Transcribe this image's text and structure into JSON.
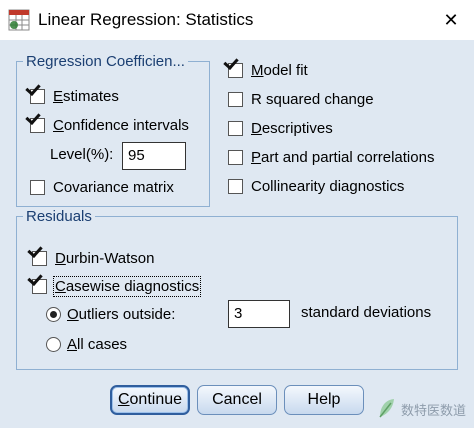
{
  "window": {
    "title": "Linear Regression: Statistics",
    "close_label": "✕"
  },
  "regression_coefficients": {
    "legend": "Regression Coefficien...",
    "estimates": {
      "label": "Estimates",
      "checked": true
    },
    "confidence_intervals": {
      "label": "Confidence intervals",
      "checked": true
    },
    "level_label": "Level(%):",
    "level_value": "95",
    "covariance_matrix": {
      "label": "Covariance matrix",
      "checked": false
    }
  },
  "options": {
    "model_fit": {
      "label": "Model fit",
      "checked": true
    },
    "r_squared_change": {
      "label": "R squared change",
      "checked": false
    },
    "descriptives": {
      "label": "Descriptives",
      "checked": false
    },
    "part_partial": {
      "label": "Part and partial correlations",
      "checked": false
    },
    "collinearity": {
      "label": "Collinearity diagnostics",
      "checked": false
    }
  },
  "residuals": {
    "legend": "Residuals",
    "durbin_watson": {
      "label": "Durbin-Watson",
      "checked": true
    },
    "casewise": {
      "label": "Casewise diagnostics",
      "checked": true
    },
    "outliers_outside": {
      "label": "Outliers outside:",
      "selected": true
    },
    "outliers_value": "3",
    "std_dev_label": "standard deviations",
    "all_cases": {
      "label": "All cases",
      "selected": false
    }
  },
  "buttons": {
    "continue": "Continue",
    "cancel": "Cancel",
    "help": "Help"
  },
  "watermark": "数特医数道",
  "icons": {
    "app": "regression-app-icon",
    "close": "close-icon",
    "watermark": "leaf-logo-icon"
  }
}
